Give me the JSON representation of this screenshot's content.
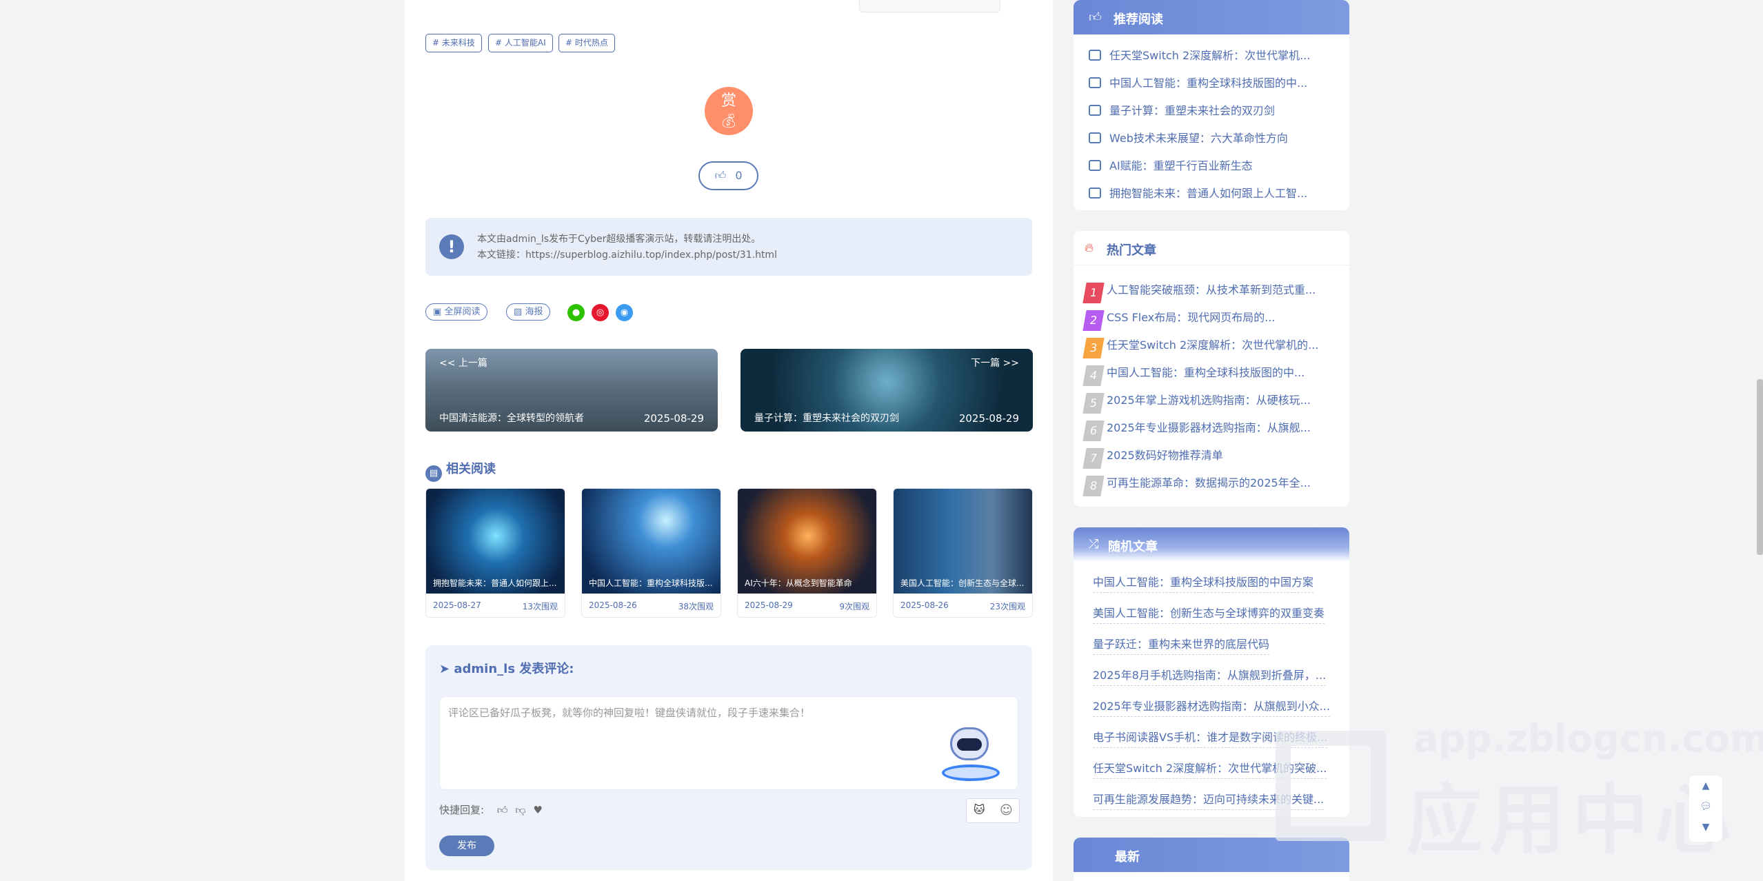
{
  "article": {
    "tags": [
      "# 未来科技",
      "# 人工智能AI",
      "# 时代热点"
    ],
    "reward_label": "赏",
    "like_count": "0",
    "notice_line1": "本文由admin_ls发布于Cyber超级播客演示站，转载请注明出处。",
    "notice_line2": "本文链接：https://superblog.aizhilu.top/index.php/post/31.html",
    "actions": {
      "fullscreen": "全屏阅读",
      "poster": "海报"
    },
    "prev": {
      "label": "<< 上一篇",
      "title": "中国清洁能源：全球转型的领航者",
      "date": "2025-08-29"
    },
    "next": {
      "label": "下一篇 >>",
      "title": "量子计算：重塑未来社会的双刃剑",
      "date": "2025-08-29"
    }
  },
  "related": {
    "title": "相关阅读",
    "items": [
      {
        "caption": "拥抱智能未来：普通人如何跟上...",
        "date": "2025-08-27",
        "views": "13次围观"
      },
      {
        "caption": "中国人工智能：重构全球科技版...",
        "date": "2025-08-26",
        "views": "38次围观"
      },
      {
        "caption": "AI六十年：从概念到智能革命",
        "date": "2025-08-29",
        "views": "9次围观"
      },
      {
        "caption": "美国人工智能：创新生态与全球...",
        "date": "2025-08-26",
        "views": "23次围观"
      }
    ]
  },
  "comment": {
    "heading": "admin_ls 发表评论:",
    "placeholder": "评论区已备好瓜子板凳，就等你的神回复啦！键盘侠请就位，段子手速来集合！",
    "quick_reply": "快捷回复:",
    "submit": "发布"
  },
  "sidebar": {
    "recommend": {
      "title": "推荐阅读",
      "items": [
        "任天堂Switch 2深度解析：次世代掌机...",
        "中国人工智能：重构全球科技版图的中...",
        "量子计算：重塑未来社会的双刃剑",
        "Web技术未来展望：六大革命性方向",
        "AI赋能：重塑千行百业新生态",
        "拥抱智能未来：普通人如何跟上人工智..."
      ]
    },
    "hot": {
      "title": "热门文章",
      "items": [
        {
          "n": "1",
          "t": "人工智能突破瓶颈：从技术革新到范式重..."
        },
        {
          "n": "2",
          "t": "CSS Flex布局：现代网页布局的..."
        },
        {
          "n": "3",
          "t": "任天堂Switch 2深度解析：次世代掌机的..."
        },
        {
          "n": "4",
          "t": "中国人工智能：重构全球科技版图的中..."
        },
        {
          "n": "5",
          "t": "2025年掌上游戏机选购指南：从硬核玩..."
        },
        {
          "n": "6",
          "t": "2025年专业摄影器材选购指南：从旗舰..."
        },
        {
          "n": "7",
          "t": "2025数码好物推荐清单"
        },
        {
          "n": "8",
          "t": "可再生能源革命：数据揭示的2025年全..."
        }
      ],
      "colors": [
        "#e84a5f",
        "#b65cf0",
        "#f7a440",
        "#c8c8c8",
        "#c8c8c8",
        "#c8c8c8",
        "#c8c8c8",
        "#c8c8c8"
      ]
    },
    "random": {
      "title": "随机文章",
      "items": [
        "中国人工智能：重构全球科技版图的中国方案",
        "美国人工智能：创新生态与全球博弈的双重变奏",
        "量子跃迁：重构未来世界的底层代码",
        "2025年8月手机选购指南：从旗舰到折叠屏，...",
        "2025年专业摄影器材选购指南：从旗舰到小众...",
        "电子书阅读器VS手机：谁才是数字阅读的终极...",
        "任天堂Switch 2深度解析：次世代掌机的突破...",
        "可再生能源发展趋势：迈向可持续未来的关键..."
      ]
    },
    "latest": {
      "title": "最新"
    }
  },
  "watermark": {
    "line1": "app.zblogcn.com",
    "line2": "应用中心"
  },
  "colors": {
    "accent": "#5a7ab8",
    "reward": "#ff8f6b",
    "notice_bg": "#e8eef9"
  }
}
